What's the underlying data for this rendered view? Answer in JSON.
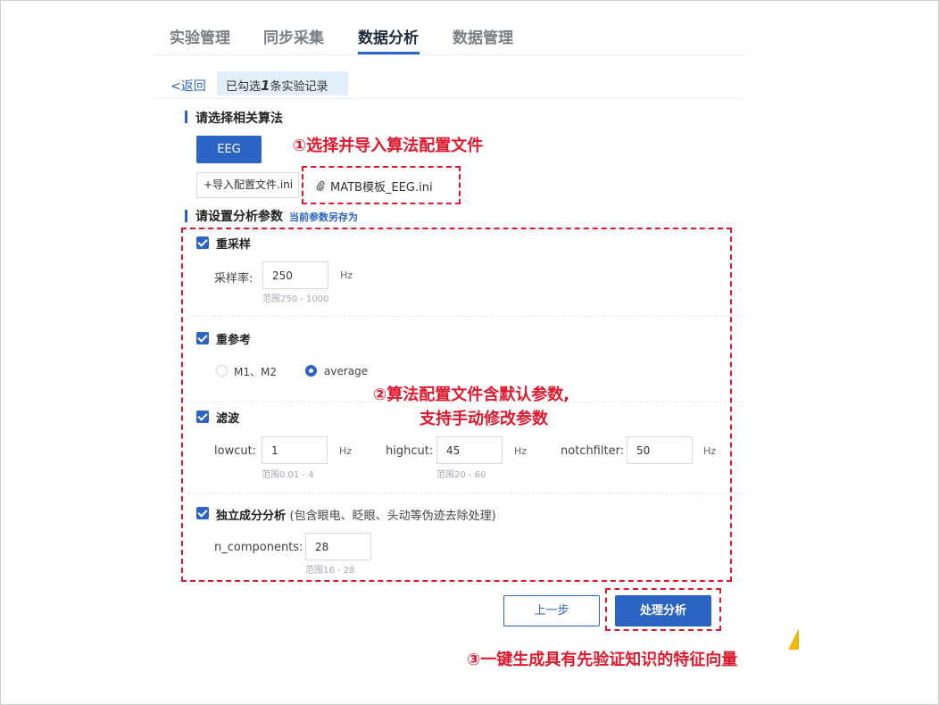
{
  "tabs": [
    {
      "label": "实验管理",
      "active": false
    },
    {
      "label": "同步采集",
      "active": false
    },
    {
      "label": "数据分析",
      "active": true
    },
    {
      "label": "数据管理",
      "active": false
    }
  ],
  "back": {
    "label": "<返回"
  },
  "selection": {
    "prefix": "已勾选",
    "count": "1",
    "suffix": "条实验记录"
  },
  "algorithm_section": {
    "title": "请选择相关算法",
    "algorithm_button": "EEG",
    "import_button": "+导入配置文件.ini",
    "file_name": "MATB模板_EEG.ini"
  },
  "params_section": {
    "title": "请设置分析参数",
    "save_link": "当前参数另存为"
  },
  "resample": {
    "checked": true,
    "label": "重采样",
    "rate_label": "采样率:",
    "rate_value": "250",
    "rate_unit": "Hz",
    "rate_range": "范围250 - 1000"
  },
  "rereference": {
    "checked": true,
    "label": "重参考",
    "options": [
      {
        "label": "M1、M2",
        "selected": false
      },
      {
        "label": "average",
        "selected": true
      }
    ]
  },
  "filter": {
    "checked": true,
    "label": "滤波",
    "lowcut": {
      "label": "lowcut:",
      "value": "1",
      "unit": "Hz",
      "range": "范围0.01 - 4"
    },
    "highcut": {
      "label": "highcut:",
      "value": "45",
      "unit": "Hz",
      "range": "范围20 - 60"
    },
    "notch": {
      "label": "notchfilter:",
      "value": "50",
      "unit": "Hz"
    }
  },
  "ica": {
    "checked": true,
    "label": "独立成分分析",
    "hint": "(包含眼电、眨眼、头动等伪迹去除处理)",
    "n_label": "n_components:",
    "n_value": "28",
    "n_range": "范围16 - 28"
  },
  "actions": {
    "prev": "上一步",
    "process": "处理分析"
  },
  "annotations": {
    "note1": "①选择并导入算法配置文件",
    "note2_line1": "②算法配置文件含默认参数,",
    "note2_line2": "支持手动修改参数",
    "note3": "③一键生成具有先验证知识的特征向量"
  },
  "colors": {
    "accent": "#2b64c2",
    "annotation_red": "#e0182d",
    "marker_yellow": "#f2b800"
  }
}
